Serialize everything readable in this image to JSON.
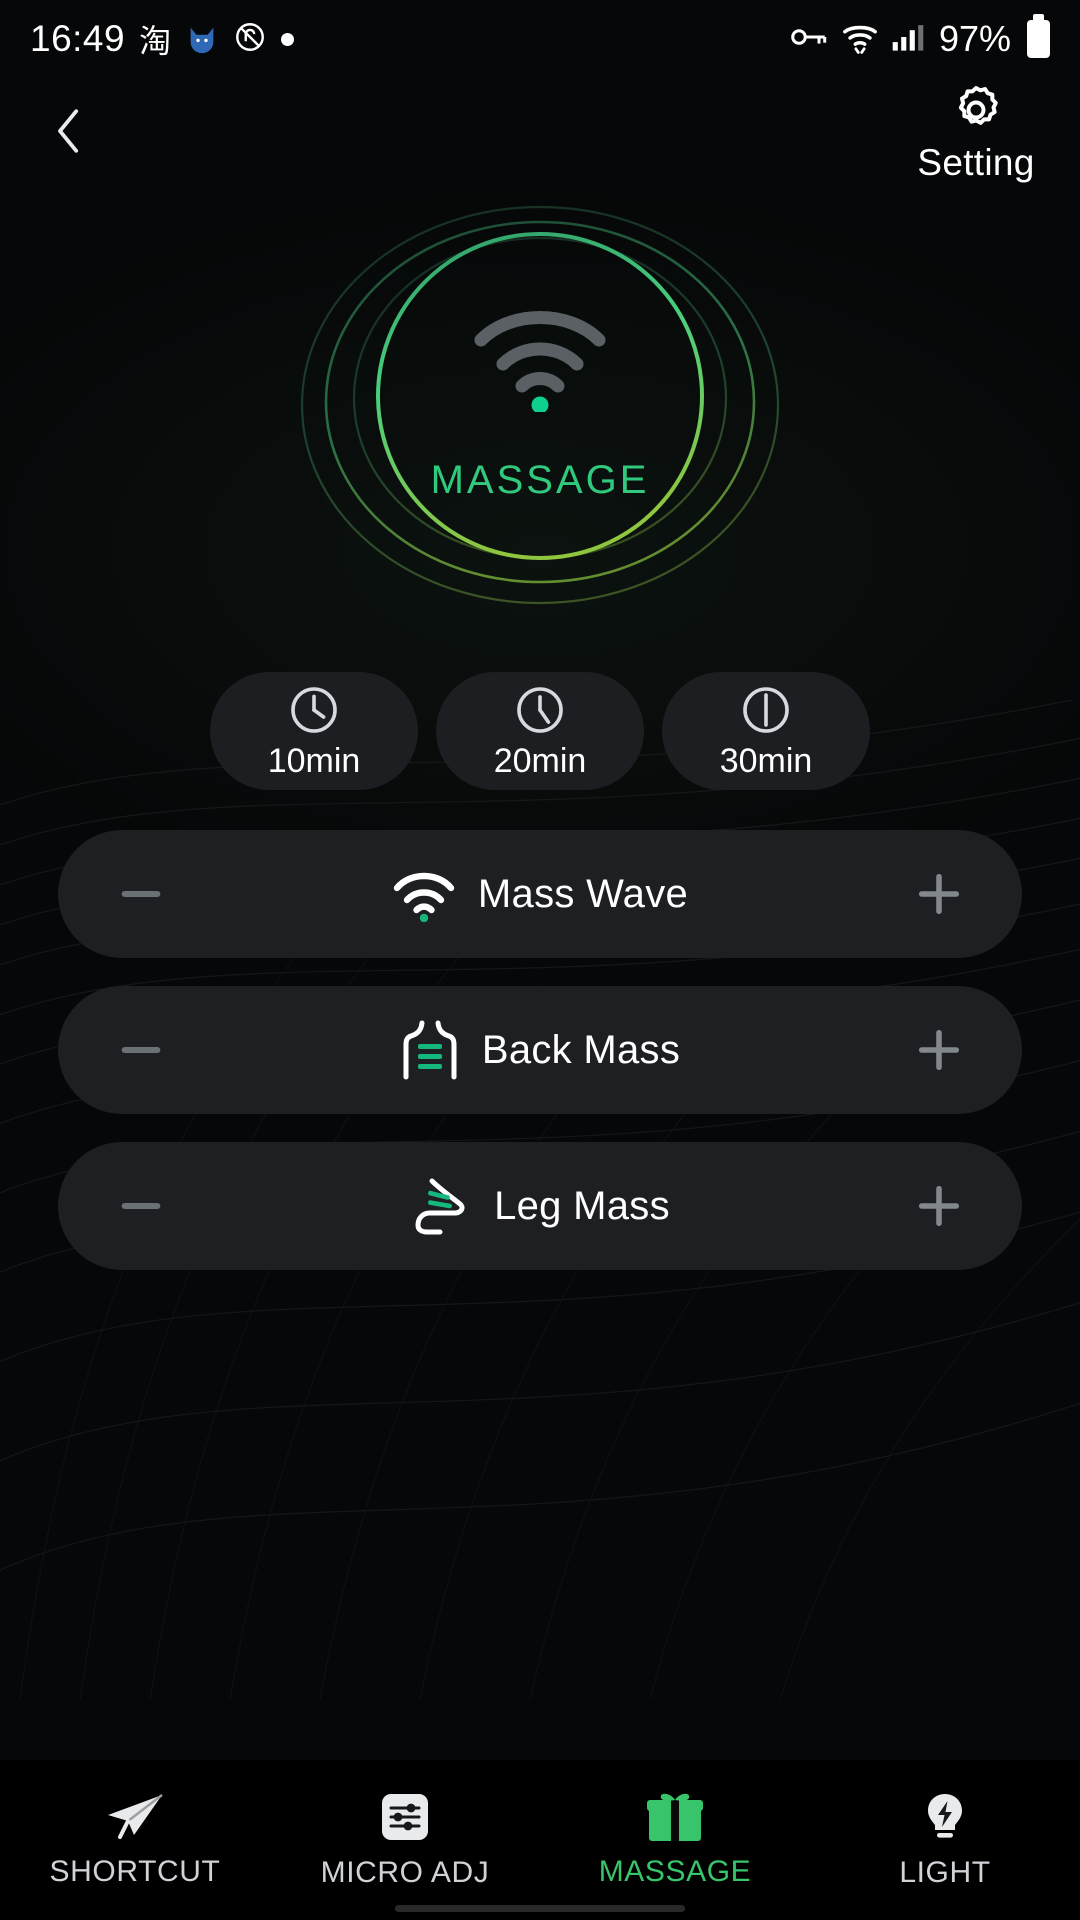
{
  "statusbar": {
    "time": "16:49",
    "app_icon_cn": "淘",
    "cat_icon": "cat-icon",
    "mute_icon": "ringer-off-icon",
    "dot_icon": "dot-indicator-icon",
    "vpn_key_icon": "vpn-key-icon",
    "wifi_icon": "wifi-icon",
    "signal_icon": "cellular-signal-icon",
    "battery_percent": "97%",
    "battery_icon": "battery-full-icon"
  },
  "header": {
    "back_icon": "chevron-left-icon",
    "setting_icon": "gear-icon",
    "setting_label": "Setting"
  },
  "hero": {
    "mode_label": "MASSAGE",
    "icon": "wifi-wave-icon",
    "ring_color_outer": "#2c6b46",
    "ring_color_mid": "#3fbf6e",
    "ring_color_inner": "#4cd07c",
    "ring_color_accent": "#86c232",
    "label_color": "#31c97d",
    "dot_color": "#0ed18c"
  },
  "timers": [
    {
      "label": "10min",
      "icon": "clock-10-icon"
    },
    {
      "label": "20min",
      "icon": "clock-20-icon"
    },
    {
      "label": "30min",
      "icon": "clock-30-icon"
    }
  ],
  "controls": [
    {
      "label": "Mass Wave",
      "icon": "wifi-wave-icon",
      "minus_icon": "minus-icon",
      "plus_icon": "plus-icon"
    },
    {
      "label": "Back Mass",
      "icon": "back-torso-icon",
      "minus_icon": "minus-icon",
      "plus_icon": "plus-icon"
    },
    {
      "label": "Leg Mass",
      "icon": "leg-foot-icon",
      "minus_icon": "minus-icon",
      "plus_icon": "plus-icon"
    }
  ],
  "bottomnav": {
    "active_color": "#38c46a",
    "items": [
      {
        "label": "SHORTCUT",
        "icon": "paper-plane-icon",
        "active": false
      },
      {
        "label": "MICRO ADJ",
        "icon": "sliders-icon",
        "active": false
      },
      {
        "label": "MASSAGE",
        "icon": "gift-box-icon",
        "active": true
      },
      {
        "label": "LIGHT",
        "icon": "lightbulb-bolt-icon",
        "active": false
      }
    ]
  }
}
